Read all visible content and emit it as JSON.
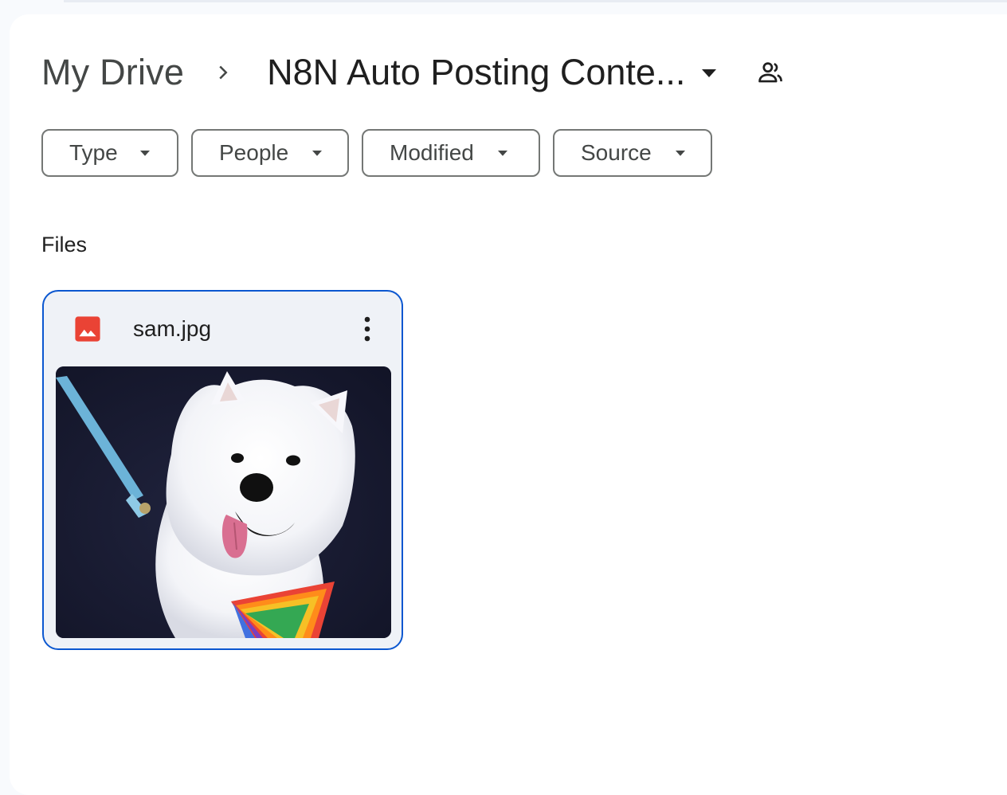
{
  "breadcrumb": {
    "root": "My Drive",
    "current": "N8N Auto Posting Conte..."
  },
  "filters": [
    {
      "label": "Type"
    },
    {
      "label": "People"
    },
    {
      "label": "Modified"
    },
    {
      "label": "Source"
    }
  ],
  "icons": {
    "separator": "chevron-right-icon",
    "folder_menu": "caret-down-icon",
    "shared": "people-icon",
    "file_type": "image-file-icon",
    "more": "more-vert-icon"
  },
  "files_section": {
    "title": "Files"
  },
  "files": [
    {
      "name": "sam.jpg",
      "type": "image",
      "selected": true
    }
  ],
  "colors": {
    "selection_border": "#0b57d0",
    "image_icon": "#ea4335",
    "card_background": "#eff2f7"
  }
}
